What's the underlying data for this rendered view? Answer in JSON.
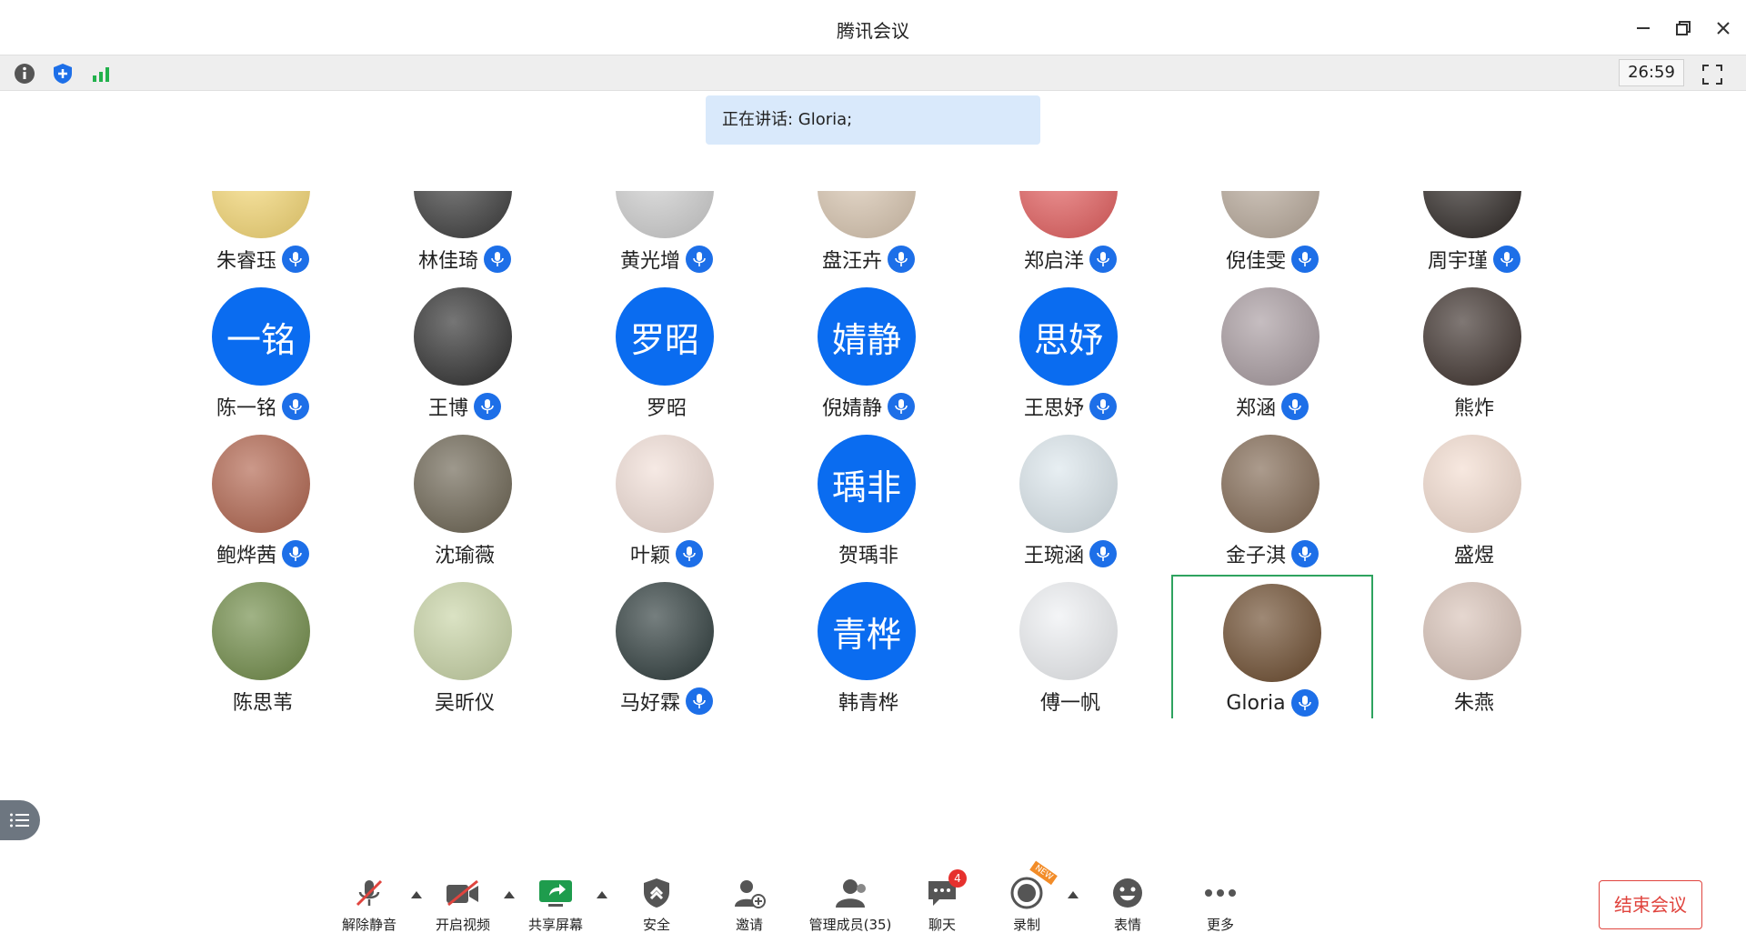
{
  "window": {
    "title": "腾讯会议"
  },
  "toolbar": {
    "timer": "26:59"
  },
  "speaking": "正在讲话: Gloria;",
  "participants": [
    {
      "name": "朱睿珏",
      "mic": true,
      "avatar_text": "",
      "photo": true,
      "bg": "#f6d873"
    },
    {
      "name": "林佳琦",
      "mic": true,
      "avatar_text": "",
      "photo": true,
      "bg": "#3a3a3a"
    },
    {
      "name": "黄光增",
      "mic": true,
      "avatar_text": "",
      "photo": true,
      "bg": "#cfcfcf"
    },
    {
      "name": "盘汪卉",
      "mic": true,
      "avatar_text": "",
      "photo": true,
      "bg": "#d9c6b0"
    },
    {
      "name": "郑启洋",
      "mic": true,
      "avatar_text": "",
      "photo": true,
      "bg": "#e45d5d"
    },
    {
      "name": "倪佳雯",
      "mic": true,
      "avatar_text": "",
      "photo": true,
      "bg": "#b8a99a"
    },
    {
      "name": "周宇瑾",
      "mic": true,
      "avatar_text": "",
      "photo": true,
      "bg": "#2b2522"
    },
    {
      "name": "陈一铭",
      "mic": true,
      "avatar_text": "一铭",
      "photo": false
    },
    {
      "name": "王博",
      "mic": true,
      "avatar_text": "",
      "photo": true,
      "bg": "#2c2c2c"
    },
    {
      "name": "罗昭",
      "mic": false,
      "avatar_text": "罗昭",
      "photo": false
    },
    {
      "name": "倪婧静",
      "mic": true,
      "avatar_text": "婧静",
      "photo": false
    },
    {
      "name": "王思妤",
      "mic": true,
      "avatar_text": "思妤",
      "photo": false
    },
    {
      "name": "郑涵",
      "mic": true,
      "avatar_text": "",
      "photo": true,
      "bg": "#a79a9f"
    },
    {
      "name": "熊炸",
      "mic": false,
      "avatar_text": "",
      "photo": true,
      "bg": "#3b2f2a"
    },
    {
      "name": "鲍烨茜",
      "mic": true,
      "avatar_text": "",
      "photo": true,
      "bg": "#b0624b"
    },
    {
      "name": "沈瑜薇",
      "mic": false,
      "avatar_text": "",
      "photo": true,
      "bg": "#6a6250"
    },
    {
      "name": "叶颖",
      "mic": true,
      "avatar_text": "",
      "photo": true,
      "bg": "#f1ded6"
    },
    {
      "name": "贺瑀非",
      "mic": false,
      "avatar_text": "瑀非",
      "photo": false
    },
    {
      "name": "王琬涵",
      "mic": true,
      "avatar_text": "",
      "photo": true,
      "bg": "#dbe6ec"
    },
    {
      "name": "金子淇",
      "mic": true,
      "avatar_text": "",
      "photo": true,
      "bg": "#7f6650"
    },
    {
      "name": "盛煜",
      "mic": false,
      "avatar_text": "",
      "photo": true,
      "bg": "#f3dccf"
    },
    {
      "name": "陈思苇",
      "mic": false,
      "avatar_text": "",
      "photo": true,
      "bg": "#6e8a45"
    },
    {
      "name": "吴昕仪",
      "mic": false,
      "avatar_text": "",
      "photo": true,
      "bg": "#c7d3a4"
    },
    {
      "name": "马好霖",
      "mic": true,
      "avatar_text": "",
      "photo": true,
      "bg": "#2c3a3a"
    },
    {
      "name": "韩青桦",
      "mic": false,
      "avatar_text": "青桦",
      "photo": false
    },
    {
      "name": "傅一帆",
      "mic": false,
      "avatar_text": "",
      "photo": true,
      "bg": "#eef0f3"
    },
    {
      "name": "Gloria",
      "mic": true,
      "avatar_text": "",
      "photo": true,
      "bg": "#6b4a2c",
      "active": true
    },
    {
      "name": "朱燕",
      "mic": false,
      "avatar_text": "",
      "photo": true,
      "bg": "#d8c2b7"
    }
  ],
  "bottombar": {
    "unmute": "解除静音",
    "video": "开启视频",
    "share": "共享屏幕",
    "security": "安全",
    "invite": "邀请",
    "members": "管理成员(35)",
    "chat": "聊天",
    "chat_badge": "4",
    "record": "录制",
    "record_tag": "NEW",
    "emoji": "表情",
    "more": "更多",
    "end": "结束会议"
  },
  "colors": {
    "accent": "#0a6cf0",
    "active_border": "#2ea35f",
    "end": "#e0443e"
  }
}
